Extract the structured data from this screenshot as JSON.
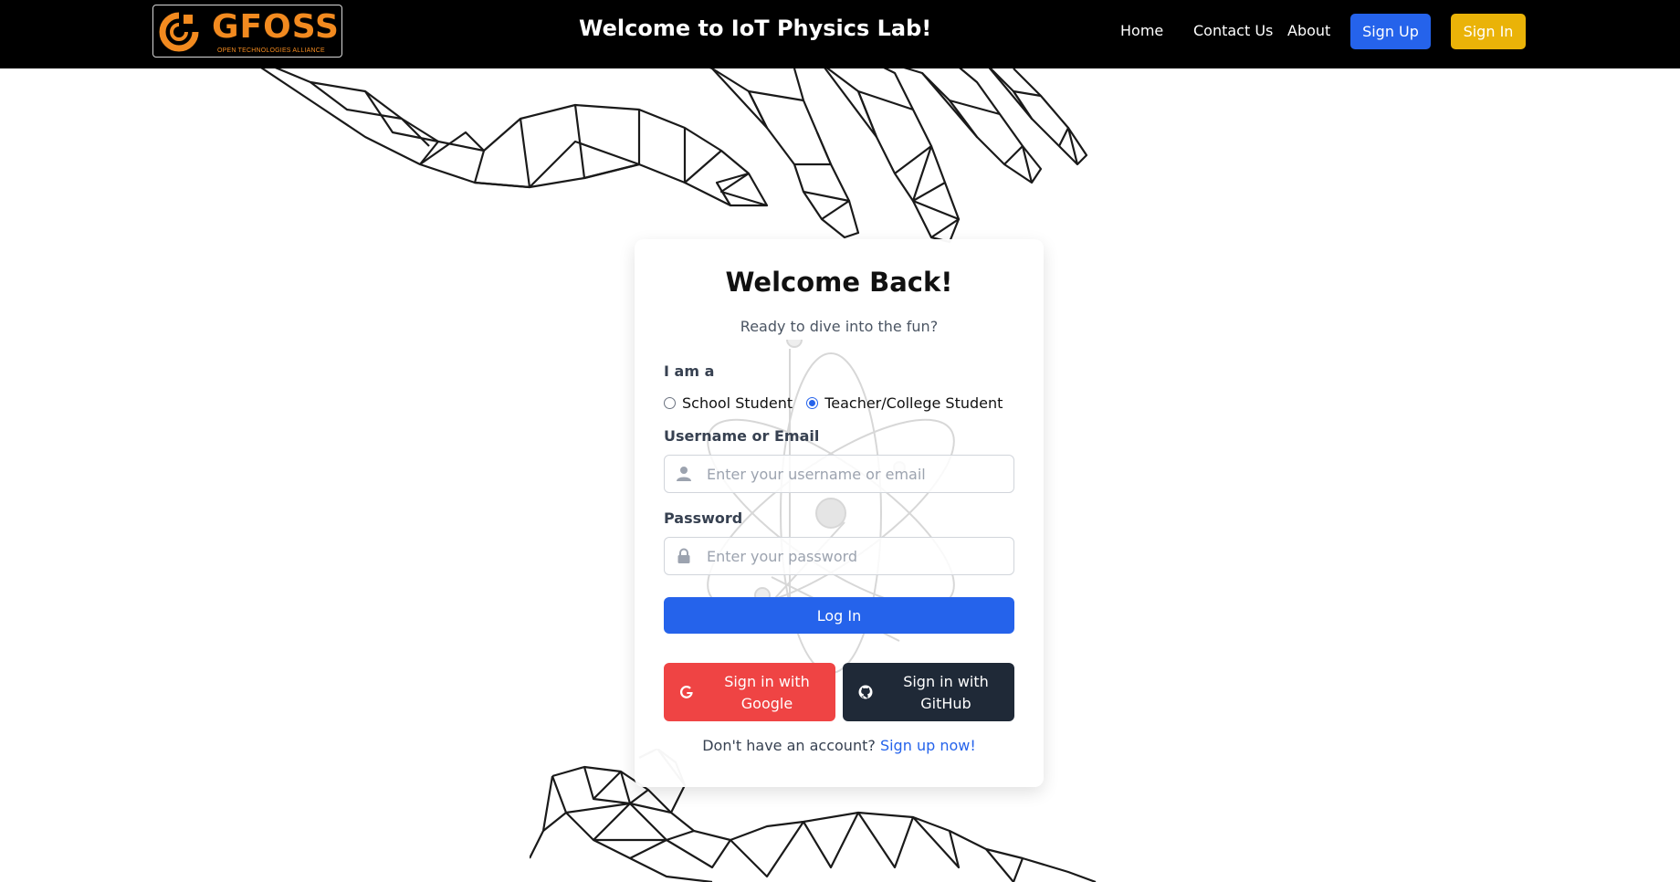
{
  "header": {
    "logo_text": "GFOSS",
    "logo_subtext": "OPEN TECHNOLOGIES ALLIANCE",
    "title": "Welcome to IoT Physics Lab!",
    "nav": {
      "home": "Home",
      "contact": "Contact Us",
      "about": "About"
    },
    "signup_label": "Sign Up",
    "signin_label": "Sign In"
  },
  "card": {
    "title": "Welcome Back!",
    "subtitle": "Ready to dive into the fun?",
    "role_label": "I am a",
    "roles": [
      {
        "label": "School Student",
        "checked": false
      },
      {
        "label": "Teacher/College Student",
        "checked": true
      }
    ],
    "username": {
      "label": "Username or Email",
      "placeholder": "Enter your username or email",
      "icon": "user-icon"
    },
    "password": {
      "label": "Password",
      "placeholder": "Enter your password",
      "icon": "lock-icon"
    },
    "login_label": "Log In",
    "google_label": "Sign in with Google",
    "github_label": "Sign in with GitHub",
    "no_account_text": "Don't have an account?",
    "signup_link": "Sign up now!"
  },
  "colors": {
    "primary": "#2563eb",
    "signin_yellow": "#eab308",
    "google_red": "#ef4444",
    "github_dark": "#1f2937",
    "logo_orange": "#f28a1f"
  }
}
